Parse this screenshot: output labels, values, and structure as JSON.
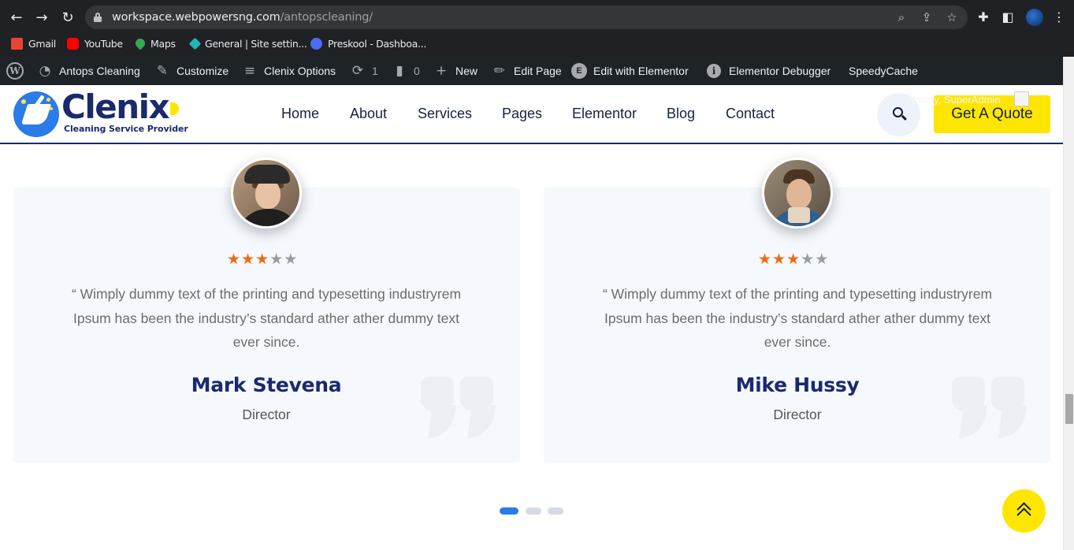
{
  "browser": {
    "url_host": "workspace.webpowersng.com",
    "url_path": "/antopscleaning/",
    "nav": {
      "back_icon": "←",
      "forward_icon": "→",
      "reload_icon": "↻"
    },
    "bookmarks": [
      {
        "label": "Gmail",
        "icon": "gmail-icon",
        "color": "#ea4335"
      },
      {
        "label": "YouTube",
        "icon": "youtube-icon",
        "color": "#ff0000"
      },
      {
        "label": "Maps",
        "icon": "maps-icon",
        "color": "#34a853"
      },
      {
        "label": "General | Site settin...",
        "icon": "diamond-icon",
        "color": "#1fb5b5"
      },
      {
        "label": "Preskool - Dashboa...",
        "icon": "globe-icon",
        "color": "#4a6cf7"
      }
    ]
  },
  "adminbar": {
    "site_name": "Antops Cleaning",
    "customize": "Customize",
    "clenix_options": "Clenix Options",
    "updates_count": "1",
    "comments_count": "0",
    "new": "New",
    "edit_page": "Edit Page",
    "edit_elementor": "Edit with Elementor",
    "debugger": "Elementor Debugger",
    "speedycache": "SpeedyCache",
    "howdy": "Howdy, SuperAdmin"
  },
  "site": {
    "logo_text": "Clenix",
    "logo_tagline": "Cleaning Service Provider",
    "menu": [
      "Home",
      "About",
      "Services",
      "Pages",
      "Elementor",
      "Blog",
      "Contact"
    ],
    "quote_button": "Get A Quote"
  },
  "testimonials": [
    {
      "rating": 3,
      "max_rating": 5,
      "quote": "“ Wimply dummy text of the printing and typesetting industryrem Ipsum has been the industry’s standard ather ather dummy text ever since.",
      "name": "Mark Stevena",
      "role": "Director"
    },
    {
      "rating": 3,
      "max_rating": 5,
      "quote": "“ Wimply dummy text of the printing and typesetting industryrem Ipsum has been the industry’s standard ather ather dummy text ever since.",
      "name": "Mike Hussy",
      "role": "Director"
    }
  ],
  "carousel": {
    "pages": 3,
    "active": 0
  },
  "colors": {
    "brand_navy": "#1a2a6c",
    "accent_yellow": "#ffe600",
    "star_on": "#f26a10",
    "star_off": "#9b9b9b",
    "dot_active": "#2b7be9",
    "dot_inactive": "#d5dbe6"
  }
}
